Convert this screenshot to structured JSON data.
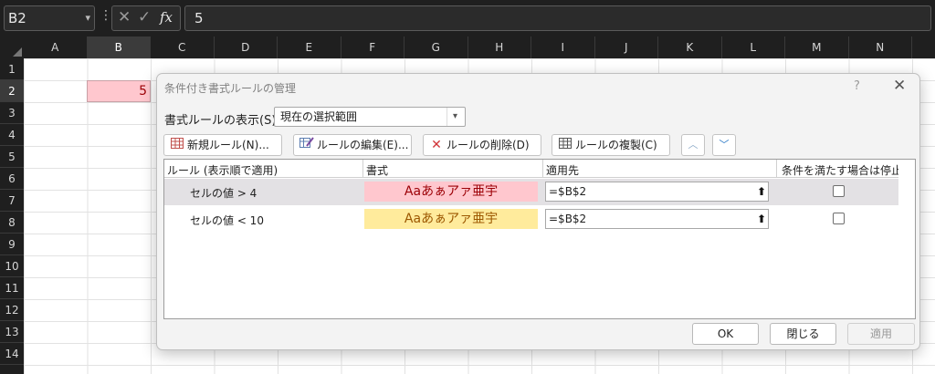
{
  "formula_bar": {
    "name_box": "B2",
    "formula_value": "5",
    "cancel_glyph": "✕",
    "enter_glyph": "✓",
    "fx_label": "fx"
  },
  "sheet": {
    "columns": [
      "A",
      "B",
      "C",
      "D",
      "E",
      "F",
      "G",
      "H",
      "I",
      "J",
      "K",
      "L",
      "M",
      "N"
    ],
    "rows": [
      "1",
      "2",
      "3",
      "4",
      "5",
      "6",
      "7",
      "8",
      "9",
      "10",
      "11",
      "12",
      "13",
      "14"
    ],
    "selected_column": "B",
    "selected_row": "2",
    "cell_b2_value": "5",
    "cell_b2_fill": "#ffc7ce",
    "cell_b2_text_color": "#9c0006"
  },
  "dialog": {
    "title": "条件付き書式ルールの管理",
    "help_glyph": "?",
    "close_glyph": "✕",
    "show_rules_label": "書式ルールの表示(S):",
    "show_rules_value": "現在の選択範囲",
    "toolbar": {
      "new_rule": "新規ルール(N)...",
      "edit_rule": "ルールの編集(E)...",
      "delete_rule": "ルールの削除(D)",
      "duplicate_rule": "ルールの複製(C)",
      "move_up_glyph": "︿",
      "move_down_glyph": "﹀"
    },
    "columns": {
      "rule": "ルール (表示順で適用)",
      "format": "書式",
      "applies_to": "適用先",
      "stop_if_true": "条件を満たす場合は停止"
    },
    "rules": [
      {
        "rule": "セルの値 > 4",
        "preview": "Aaあぁアァ亜宇",
        "applies_to": "=$B$2",
        "fill": "#ffc7ce",
        "text_color": "#9c0006",
        "selected": true,
        "stop_if_true": false
      },
      {
        "rule": "セルの値 < 10",
        "preview": "Aaあぁアァ亜宇",
        "applies_to": "=$B$2",
        "fill": "#ffeb9c",
        "text_color": "#9c5700",
        "selected": false,
        "stop_if_true": false
      }
    ],
    "buttons": {
      "ok": "OK",
      "close": "閉じる",
      "apply": "適用"
    }
  }
}
